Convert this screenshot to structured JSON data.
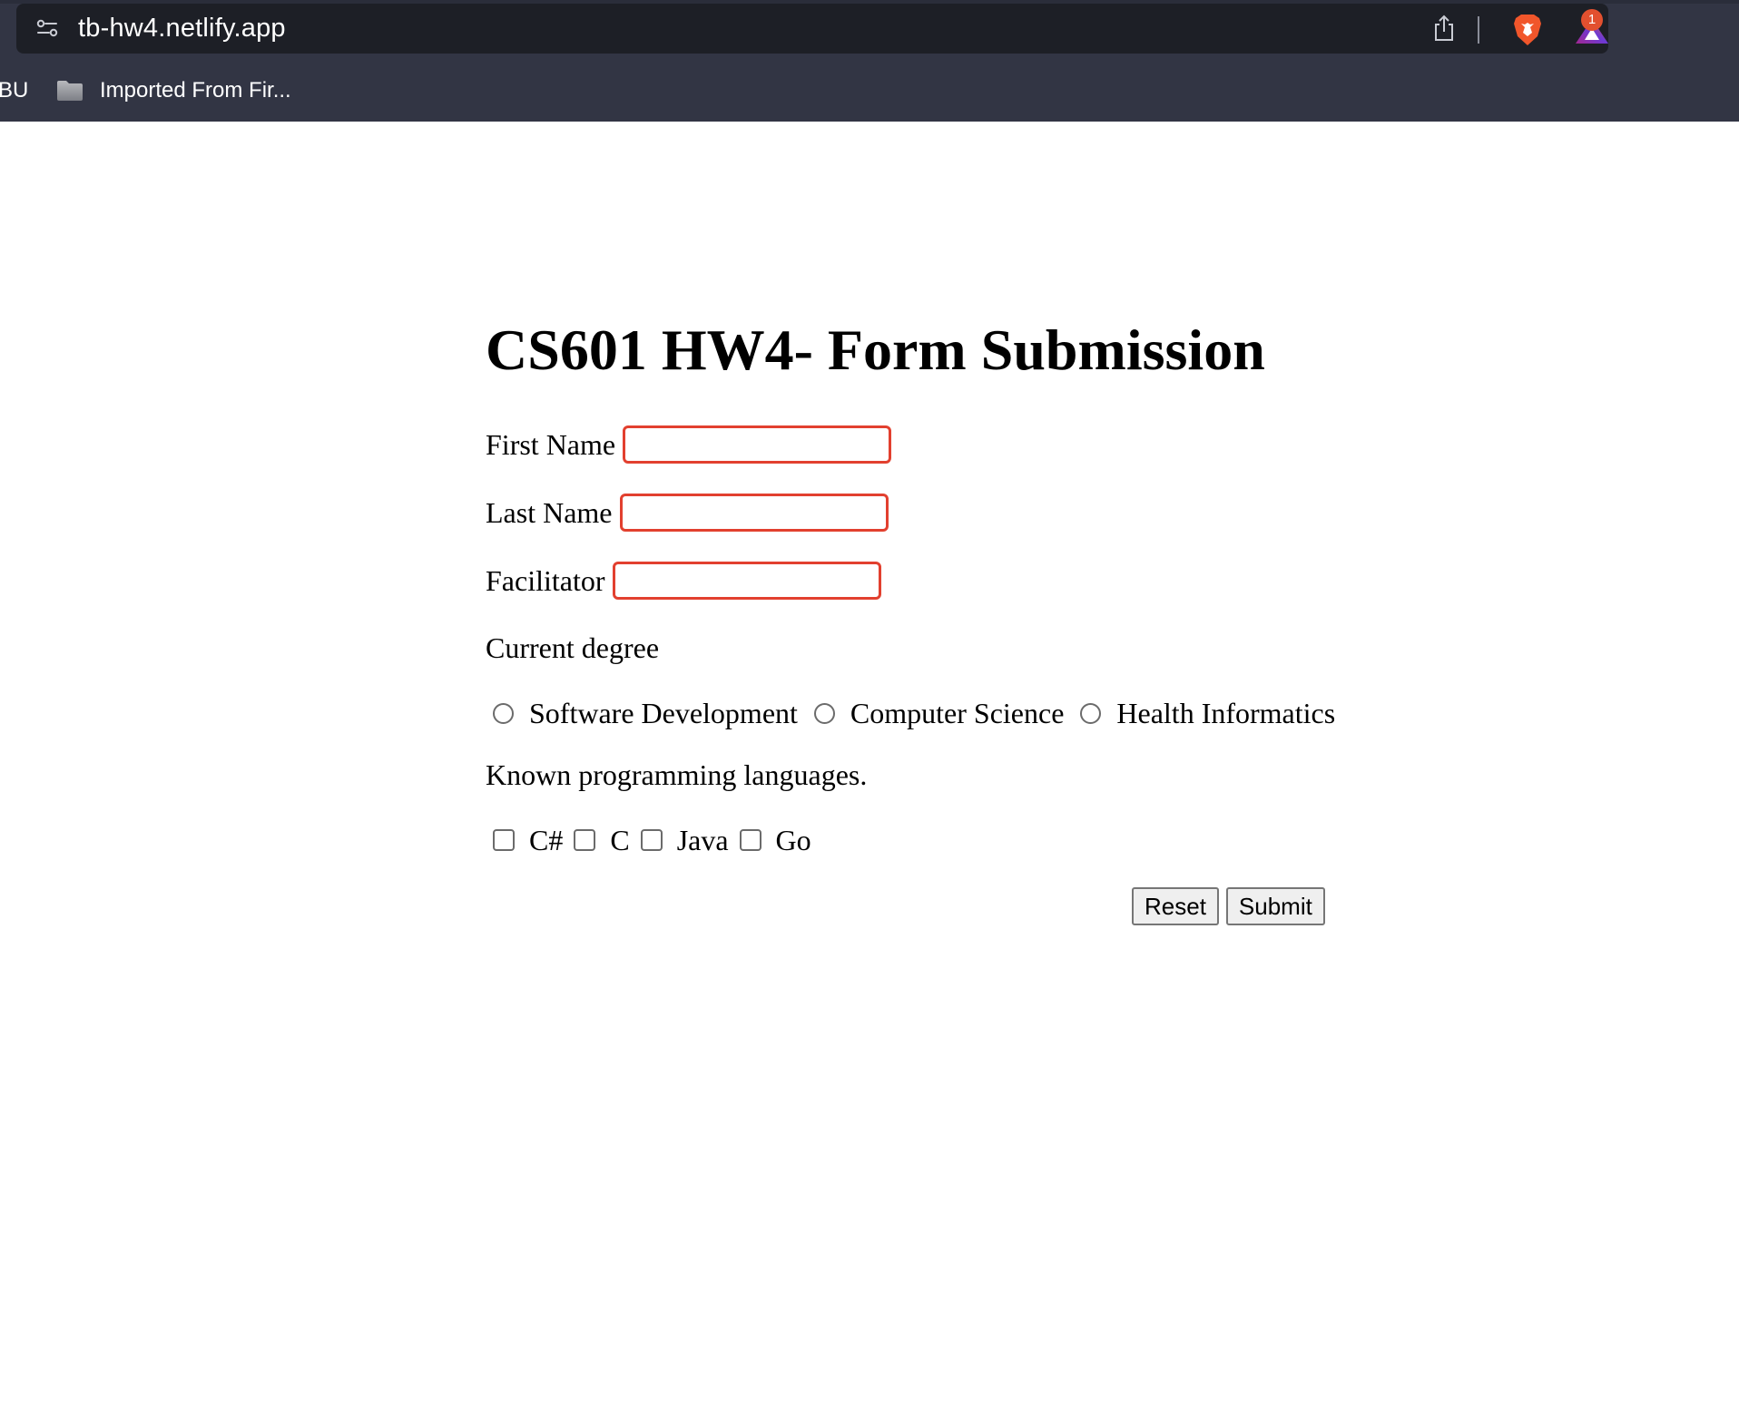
{
  "browser": {
    "url": "tb-hw4.netlify.app",
    "notification_count": "1",
    "bookmarks": [
      {
        "label": "BU"
      },
      {
        "label": "Imported From Fir..."
      }
    ],
    "icons": [
      "site-settings-icon",
      "share-icon",
      "brave-shields-icon",
      "brave-rewards-icon",
      "folder-icon"
    ]
  },
  "form": {
    "title": "CS601 HW4- Form Submission",
    "fields": [
      {
        "label": "First Name",
        "value": ""
      },
      {
        "label": "Last Name",
        "value": ""
      },
      {
        "label": "Facilitator",
        "value": ""
      }
    ],
    "degree": {
      "label": "Current degree",
      "options": [
        "Software Development",
        "Computer Science",
        "Health Informatics"
      ]
    },
    "languages": {
      "label": "Known programming languages.",
      "options": [
        "C#",
        "C",
        "Java",
        "Go"
      ]
    },
    "buttons": {
      "reset": "Reset",
      "submit": "Submit"
    },
    "colors": {
      "invalid_border": "#e2402f",
      "chrome_bg": "#323544",
      "urlbar_bg": "#1d1f26"
    }
  }
}
